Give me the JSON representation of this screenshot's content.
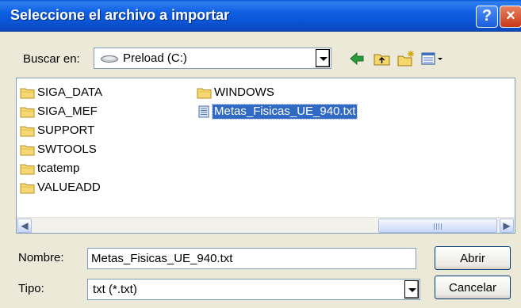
{
  "window": {
    "title": "Seleccione el archivo a importar",
    "help_glyph": "?",
    "close_glyph": "×"
  },
  "lookin": {
    "label": "Buscar en:",
    "value": "Preload (C:)",
    "value_icon": "drive-icon"
  },
  "toolbar": {
    "icons": [
      "back-icon",
      "up-folder-icon",
      "new-folder-icon",
      "view-menu-icon"
    ]
  },
  "files": {
    "column1": [
      {
        "name": "SIGA_DATA",
        "type": "folder"
      },
      {
        "name": "SIGA_MEF",
        "type": "folder"
      },
      {
        "name": "SUPPORT",
        "type": "folder"
      },
      {
        "name": "SWTOOLS",
        "type": "folder"
      },
      {
        "name": "tcatemp",
        "type": "folder"
      },
      {
        "name": "VALUEADD",
        "type": "folder"
      }
    ],
    "column2": [
      {
        "name": "WINDOWS",
        "type": "folder"
      },
      {
        "name": "Metas_Fisicas_UE_940.txt",
        "type": "file",
        "selected": true
      }
    ]
  },
  "filename": {
    "label": "Nombre:",
    "value": "Metas_Fisicas_UE_940.txt"
  },
  "filetype": {
    "label": "Tipo:",
    "value": "txt (*.txt)"
  },
  "buttons": {
    "open": "Abrir",
    "cancel": "Cancelar"
  },
  "colors": {
    "titlebar": "#0A55D6",
    "selection": "#316AC5",
    "dialog_bg": "#ECE9D8"
  }
}
